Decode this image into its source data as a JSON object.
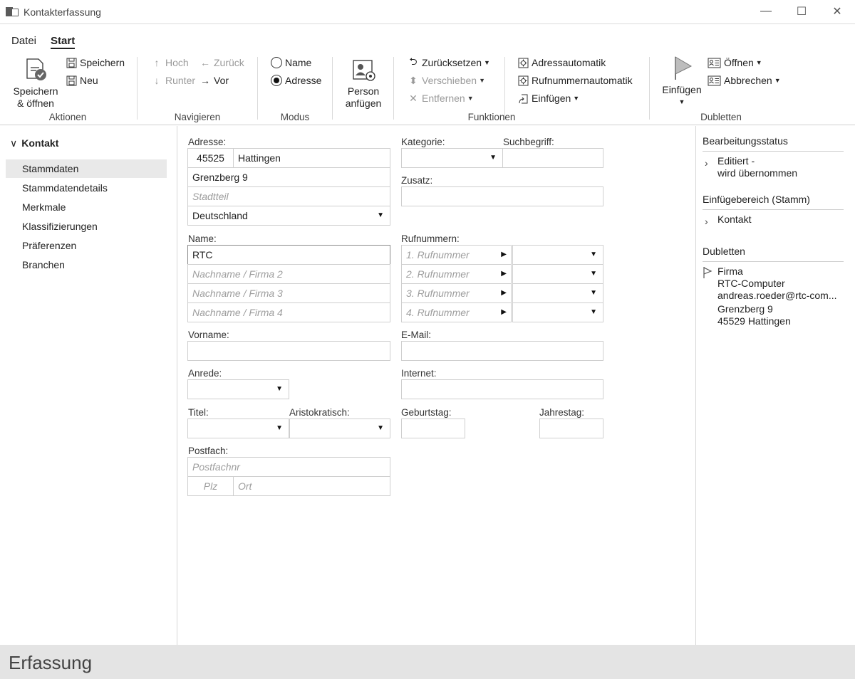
{
  "window": {
    "title": "Kontakterfassung",
    "controls": {
      "minimize": "—",
      "maximize": "☐",
      "close": "✕"
    }
  },
  "ribbon": {
    "tabs": [
      {
        "label": "Datei"
      },
      {
        "label": "Start"
      }
    ],
    "groups": {
      "aktionen": {
        "label": "Aktionen",
        "save_open_line1": "Speichern",
        "save_open_line2": "& öffnen",
        "save": "Speichern",
        "new": "Neu"
      },
      "navigieren": {
        "label": "Navigieren",
        "up": "Hoch",
        "back": "Zurück",
        "down": "Runter",
        "forward": "Vor"
      },
      "modus": {
        "label": "Modus",
        "name": "Name",
        "address": "Adresse",
        "selected": "Adresse"
      },
      "funktionen": {
        "label": "Funktionen",
        "person_line1": "Person",
        "person_line2": "anfügen",
        "reset": "Zurücksetzen",
        "move": "Verschieben",
        "remove": "Entfernen",
        "address_auto": "Adressautomatik",
        "phone_auto": "Rufnummernautomatik",
        "insert": "Einfügen"
      },
      "dubletten": {
        "label": "Dubletten",
        "insert": "Einfügen",
        "open": "Öffnen",
        "cancel": "Abbrechen"
      }
    }
  },
  "nav": {
    "header": "Kontakt",
    "items": [
      {
        "label": "Stammdaten",
        "selected": true
      },
      {
        "label": "Stammdatendetails"
      },
      {
        "label": "Merkmale"
      },
      {
        "label": "Klassifizierungen"
      },
      {
        "label": "Präferenzen"
      },
      {
        "label": "Branchen"
      }
    ]
  },
  "form": {
    "address": {
      "label": "Adresse:",
      "zip": "45525",
      "city": "Hattingen",
      "street": "Grenzberg 9",
      "district_placeholder": "Stadtteil",
      "country": "Deutschland"
    },
    "category": {
      "label": "Kategorie:",
      "value": ""
    },
    "search_term": {
      "label": "Suchbegriff:",
      "value": ""
    },
    "addition": {
      "label": "Zusatz:",
      "value": ""
    },
    "name": {
      "label": "Name:",
      "value": "RTC",
      "placeholder2": "Nachname / Firma 2",
      "placeholder3": "Nachname / Firma 3",
      "placeholder4": "Nachname / Firma 4"
    },
    "phones": {
      "label": "Rufnummern:",
      "items": [
        {
          "placeholder": "1. Rufnummer"
        },
        {
          "placeholder": "2. Rufnummer"
        },
        {
          "placeholder": "3. Rufnummer"
        },
        {
          "placeholder": "4. Rufnummer"
        }
      ]
    },
    "first_name": {
      "label": "Vorname:",
      "value": ""
    },
    "email": {
      "label": "E-Mail:",
      "value": ""
    },
    "salutation": {
      "label": "Anrede:",
      "value": ""
    },
    "internet": {
      "label": "Internet:",
      "value": ""
    },
    "title": {
      "label": "Titel:",
      "value": ""
    },
    "aristocratic": {
      "label": "Aristokratisch:",
      "value": ""
    },
    "birthday": {
      "label": "Geburtstag:",
      "value": ""
    },
    "anniversary": {
      "label": "Jahrestag:",
      "value": ""
    },
    "pobox": {
      "label": "Postfach:",
      "number_placeholder": "Postfachnr",
      "zip_placeholder": "Plz",
      "city_placeholder": "Ort"
    }
  },
  "right_panel": {
    "status_header": "Bearbeitungsstatus",
    "status_line1": "Editiert -",
    "status_line2": "wird übernommen",
    "insert_area_header": "Einfügebereich (Stamm)",
    "insert_area_item": "Kontakt",
    "duplicates_header": "Dubletten",
    "duplicate": {
      "line1": "Firma",
      "line2": "RTC-Computer",
      "line3": "andreas.roeder@rtc-com...",
      "line4": "Grenzberg 9",
      "line5": "45529 Hattingen"
    }
  },
  "statusbar": {
    "text": "Erfassung"
  }
}
